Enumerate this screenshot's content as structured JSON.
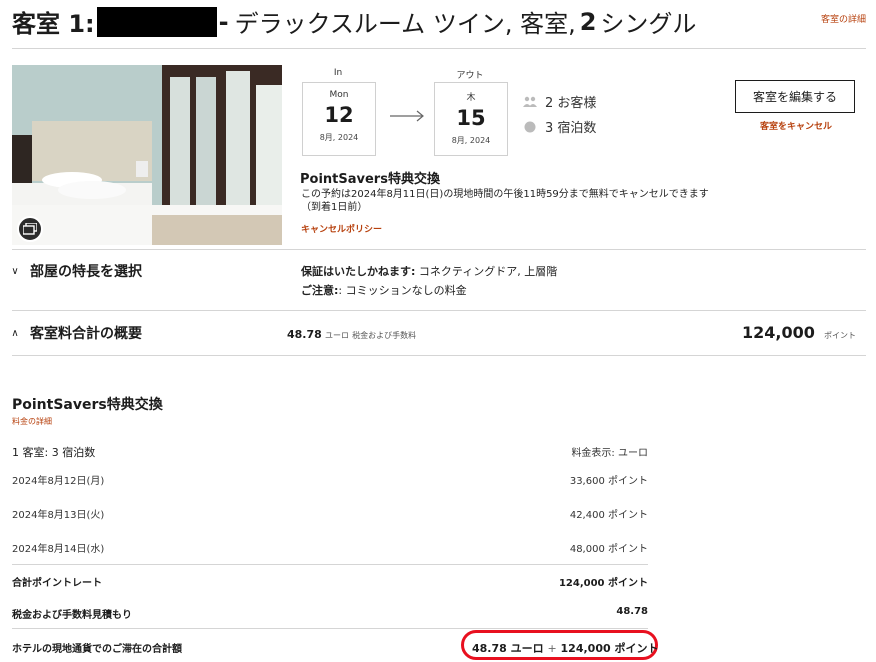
{
  "header": {
    "room_prefix": "客室 1:",
    "dash": "-",
    "room_name": "デラックスルーム ツイン, 客室,",
    "room_count": "2",
    "bed_type": "シングル",
    "detail_link": "客室の詳細"
  },
  "stay": {
    "checkin_label": "In",
    "checkin_dow": "Mon",
    "checkin_day": "12",
    "checkin_month_year": "8月, 2024",
    "checkout_label": "アウト",
    "checkout_dow": "木",
    "checkout_day": "15",
    "checkout_month_year": "8月, 2024",
    "guests": "2 お客様",
    "nights": "3 宿泊数"
  },
  "actions": {
    "edit_room": "客室を編集する",
    "cancel_room": "客室をキャンセル"
  },
  "rate": {
    "title": "PointSavers特典交換",
    "desc_line1": "この予約は2024年8月11日(日)の現地時間の午後11時59分まで無料でキャンセルできます",
    "desc_line2": "（到着1日前）",
    "cancel_policy": "キャンセルポリシー"
  },
  "preferences": {
    "section_title": "部屋の特長を選択",
    "guaranteed_label": "保証はいたしかねます:",
    "guaranteed_value": " コネクティングドア, 上層階",
    "notice_label": "ご注意:",
    "notice_value": ": コミッションなしの料金"
  },
  "summary": {
    "section_title": "客室料合計の概要",
    "euro_amount": "48.78",
    "euro_unit": "ユーロ",
    "euro_note": "税金および手数料",
    "points_amount": "124,000",
    "points_unit": "ポイント"
  },
  "breakdown": {
    "title": "PointSavers特典交換",
    "subtitle": "料金の詳細",
    "rooms_nights": "1 客室: 3 宿泊数",
    "currency_display": "料金表示: ユーロ",
    "nights": [
      {
        "date": "2024年8月12日(月)",
        "points": "33,600 ポイント"
      },
      {
        "date": "2024年8月13日(火)",
        "points": "42,400 ポイント"
      },
      {
        "date": "2024年8月14日(水)",
        "points": "48,000 ポイント"
      }
    ],
    "total_rate_label": "合計ポイントレート",
    "total_rate_value": "124,000 ポイント",
    "tax_label": "税金および手数料見積もり",
    "tax_value": "48.78",
    "grand_label": "ホテルの現地通貨でのご滞在の合計額",
    "grand_euro": "48.78 ユーロ",
    "grand_plus": "+",
    "grand_points": "124,000 ポイント"
  },
  "colors": {
    "accent": "#b7410e",
    "highlight": "#e8101f"
  }
}
